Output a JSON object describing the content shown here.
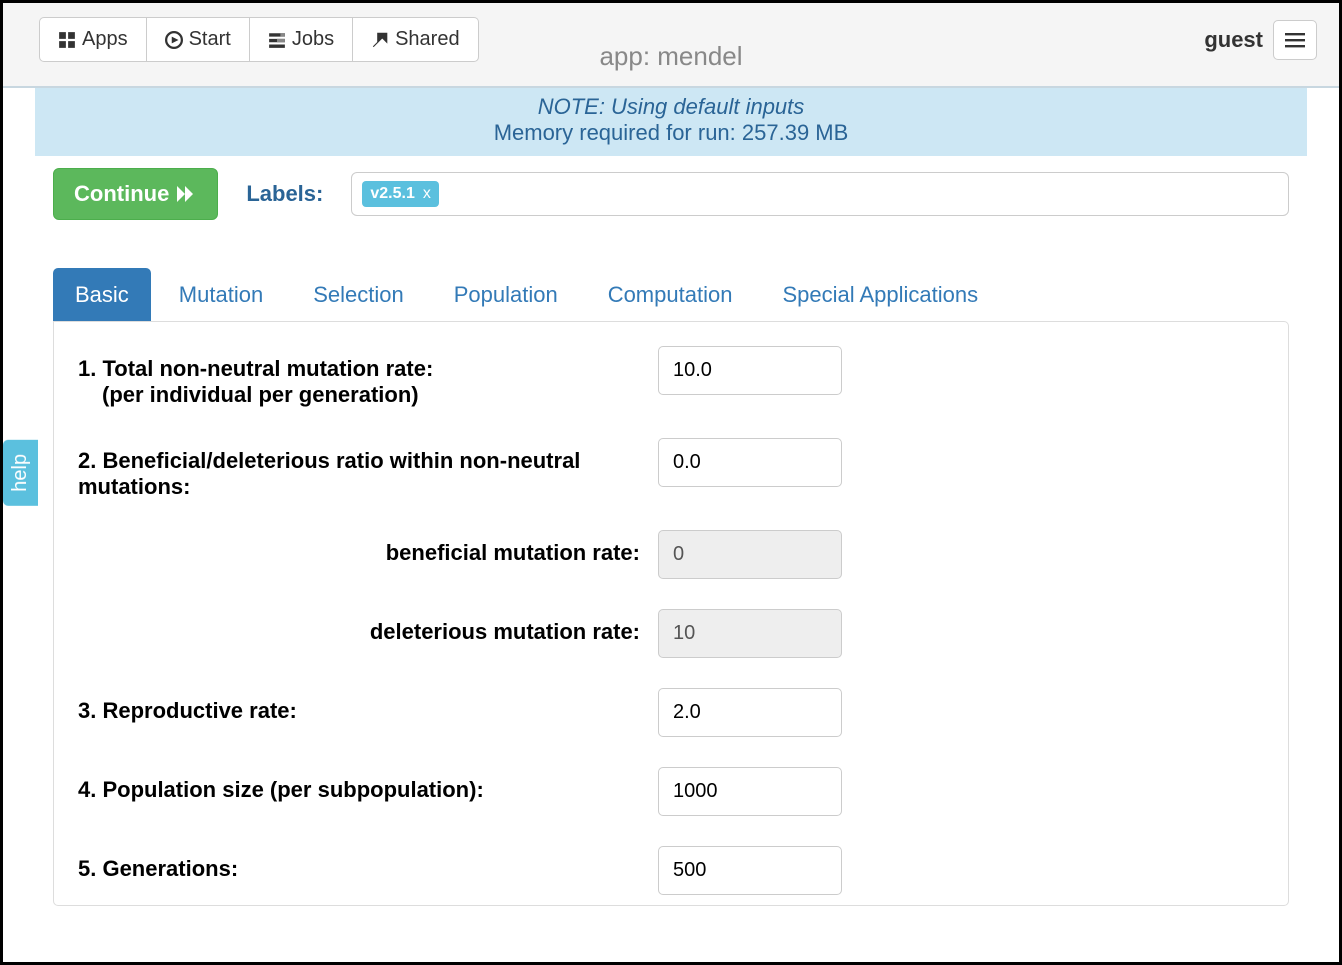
{
  "header": {
    "nav": {
      "apps": "Apps",
      "start": "Start",
      "jobs": "Jobs",
      "shared": "Shared"
    },
    "app_title": "app: mendel",
    "user": "guest"
  },
  "note": {
    "line1": "NOTE: Using default inputs",
    "line2": "Memory required for run: 257.39 MB"
  },
  "controls": {
    "continue": "Continue",
    "labels_label": "Labels:",
    "tag": "v2.5.1",
    "tag_close": "x"
  },
  "tabs": [
    {
      "id": "basic",
      "label": "Basic",
      "active": true
    },
    {
      "id": "mutation",
      "label": "Mutation",
      "active": false
    },
    {
      "id": "selection",
      "label": "Selection",
      "active": false
    },
    {
      "id": "population",
      "label": "Population",
      "active": false
    },
    {
      "id": "computation",
      "label": "Computation",
      "active": false
    },
    {
      "id": "special",
      "label": "Special Applications",
      "active": false
    }
  ],
  "form": {
    "q1": {
      "label": "1. Total non-neutral mutation rate:",
      "sub": "(per individual per generation)",
      "value": "10.0"
    },
    "q2": {
      "label": "2. Beneficial/deleterious ratio within non-neutral mutations:",
      "value": "0.0"
    },
    "q2a": {
      "label": "beneficial mutation rate:",
      "value": "0"
    },
    "q2b": {
      "label": "deleterious mutation rate:",
      "value": "10"
    },
    "q3": {
      "label": "3. Reproductive rate:",
      "value": "2.0"
    },
    "q4": {
      "label": "4. Population size (per subpopulation):",
      "value": "1000"
    },
    "q5": {
      "label": "5. Generations:",
      "value": "500"
    }
  },
  "help": "help"
}
